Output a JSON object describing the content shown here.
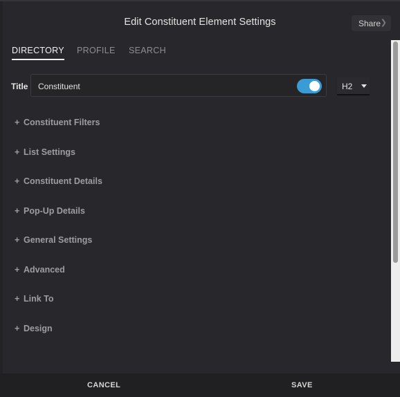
{
  "dialog": {
    "title": "Edit Constituent Element Settings",
    "share_label": "Share"
  },
  "tabs": [
    {
      "label": "DIRECTORY",
      "active": true
    },
    {
      "label": "PROFILE",
      "active": false
    },
    {
      "label": "SEARCH",
      "active": false
    }
  ],
  "title_row": {
    "label": "Title",
    "value": "Constituent",
    "toggle_on": true,
    "heading_level": "H2"
  },
  "sections": [
    {
      "label": "Constituent Filters"
    },
    {
      "label": "List Settings"
    },
    {
      "label": "Constituent Details"
    },
    {
      "label": "Pop-Up Details"
    },
    {
      "label": "General Settings"
    },
    {
      "label": "Advanced"
    },
    {
      "label": "Link To"
    },
    {
      "label": "Design"
    }
  ],
  "footer": {
    "cancel_label": "CANCEL",
    "save_label": "SAVE"
  },
  "colors": {
    "toggle_on": "#3a9bd5",
    "background": "#28282c"
  }
}
